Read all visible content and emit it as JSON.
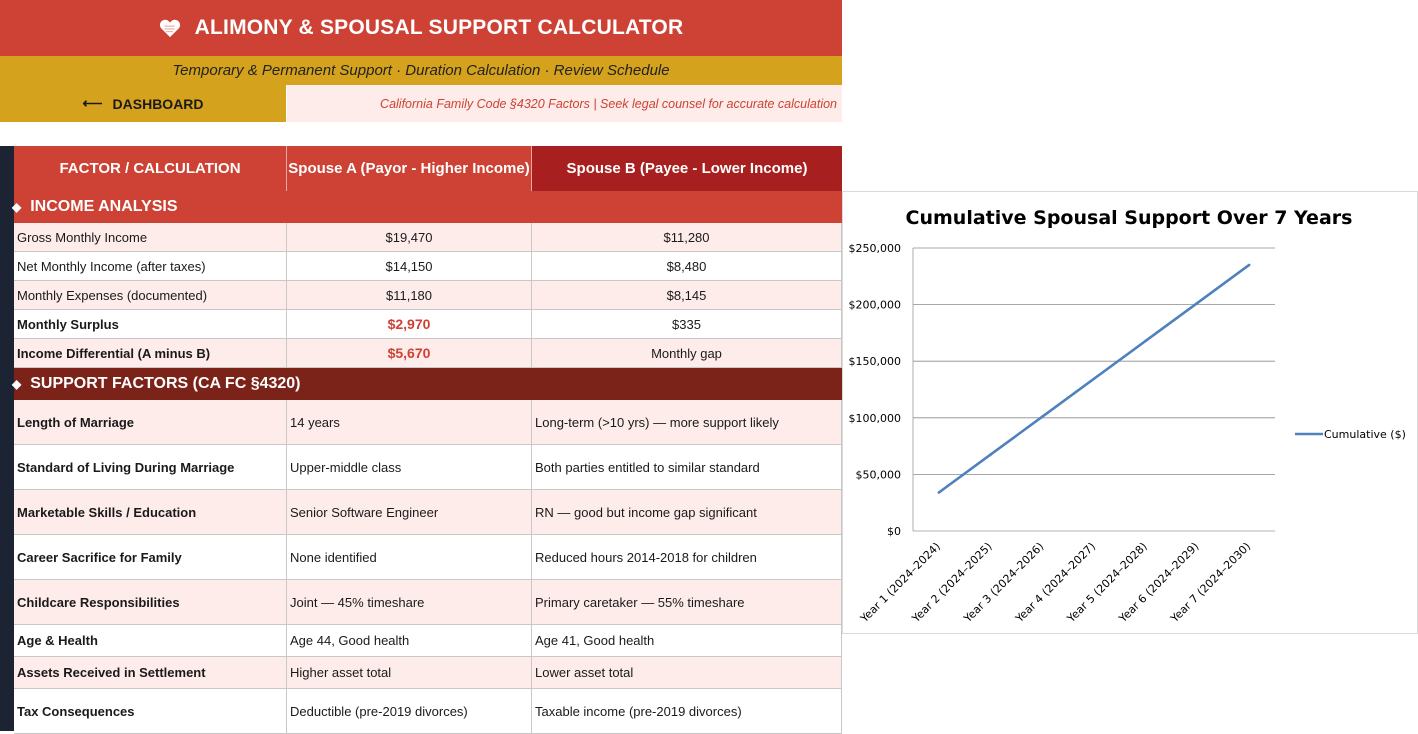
{
  "header": {
    "title": "ALIMONY & SPOUSAL SUPPORT CALCULATOR",
    "icon": "heart-icon",
    "subtitle": "Temporary & Permanent Support · Duration Calculation · Review Schedule",
    "dashboard_label": "DASHBOARD",
    "notice": "California Family Code §4320 Factors | Seek legal counsel for accurate calculation"
  },
  "columns": {
    "factor": "FACTOR / CALCULATION",
    "spouse_a": "Spouse A (Payor - Higher Income)",
    "spouse_b": "Spouse B (Payee - Lower Income)"
  },
  "sections": {
    "income": "INCOME ANALYSIS",
    "factors": "SUPPORT FACTORS (CA FC §4320)"
  },
  "income_rows": [
    {
      "label": "Gross Monthly Income",
      "a": "$19,470",
      "b": "$11,280"
    },
    {
      "label": "Net Monthly Income (after taxes)",
      "a": "$14,150",
      "b": "$8,480"
    },
    {
      "label": "Monthly Expenses (documented)",
      "a": "$11,180",
      "b": "$8,145"
    },
    {
      "label": "Monthly Surplus",
      "a": "$2,970",
      "b": "$335"
    },
    {
      "label": "Income Differential (A minus B)",
      "a": "$5,670",
      "b": "Monthly gap"
    }
  ],
  "factor_rows": [
    {
      "label": "Length of Marriage",
      "a": "14 years",
      "b": "Long-term (>10 yrs) — more support likely"
    },
    {
      "label": "Standard of Living During Marriage",
      "a": "Upper-middle class",
      "b": "Both parties entitled to similar standard"
    },
    {
      "label": "Marketable Skills / Education",
      "a": "Senior Software Engineer",
      "b": "RN — good but income gap significant"
    },
    {
      "label": "Career Sacrifice for Family",
      "a": "None identified",
      "b": "Reduced hours 2014-2018 for children"
    },
    {
      "label": "Childcare Responsibilities",
      "a": "Joint — 45% timeshare",
      "b": "Primary caretaker — 55% timeshare"
    },
    {
      "label": "Age & Health",
      "a": "Age 44, Good health",
      "b": "Age 41, Good health"
    },
    {
      "label": "Assets Received in Settlement",
      "a": "Higher asset total",
      "b": "Lower asset total"
    },
    {
      "label": "Tax Consequences",
      "a": "Deductible (pre-2019 divorces)",
      "b": "Taxable income (pre-2019 divorces)"
    }
  ],
  "colors": {
    "title_red": "#cd4234",
    "gold": "#d4a21c",
    "spouse_b_header": "#a81f1f",
    "section_dark": "#7b2219",
    "row_pink": "#fdecea",
    "navy_strip": "#1c2333",
    "chart_line": "#4f81bd"
  },
  "chart_data": {
    "type": "line",
    "title": "Cumulative Spousal Support Over 7 Years",
    "categories": [
      "Year 1 (2024–2024)",
      "Year 2 (2024–2025)",
      "Year 3 (2024–2026)",
      "Year 4 (2024–2027)",
      "Year 5 (2024–2028)",
      "Year 6 (2024–2029)",
      "Year 7 (2024–2030)"
    ],
    "series": [
      {
        "name": "Cumulative ($)",
        "values": [
          34000,
          67500,
          101000,
          134500,
          168000,
          201500,
          235000
        ]
      }
    ],
    "ylim": [
      0,
      250000
    ],
    "yticks": [
      "$0",
      "$50,000",
      "$100,000",
      "$150,000",
      "$200,000",
      "$250,000"
    ],
    "ytick_values": [
      0,
      50000,
      100000,
      150000,
      200000,
      250000
    ],
    "grid": true,
    "legend": "right"
  }
}
